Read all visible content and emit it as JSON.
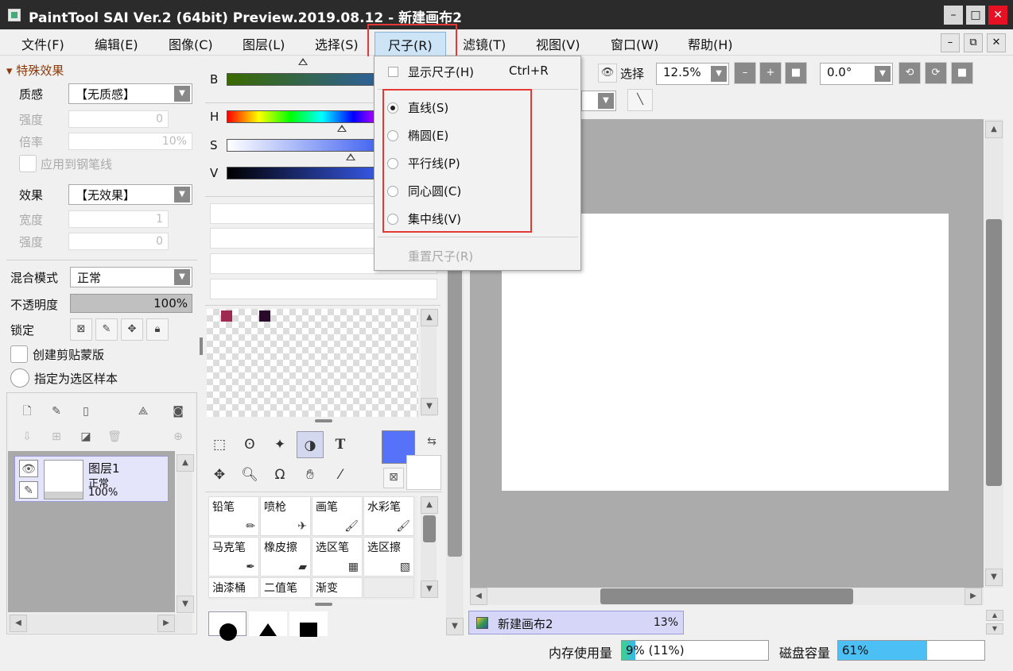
{
  "window": {
    "title": "PaintTool SAI Ver.2 (64bit) Preview.2019.08.12 - 新建画布2",
    "minimize": "–",
    "maximize": "□",
    "close": "✕"
  },
  "menubar": {
    "items": [
      "文件(F)",
      "编辑(E)",
      "图像(C)",
      "图层(L)",
      "选择(S)",
      "尺子(R)",
      "滤镜(T)",
      "视图(V)",
      "窗口(W)",
      "帮助(H)"
    ],
    "active_index": 5
  },
  "ruler_menu": {
    "show_ruler": "显示尺子(H)",
    "show_ruler_shortcut": "Ctrl+R",
    "modes": [
      "直线(S)",
      "椭圆(E)",
      "平行线(P)",
      "同心圆(C)",
      "集中线(V)"
    ],
    "selected_mode_index": 0,
    "reset": "重置尺子(R)"
  },
  "special_effects": {
    "header": "特殊效果",
    "texture_label": "质感",
    "texture_value": "【无质感】",
    "strength_label": "强度",
    "strength_value": "0",
    "scale_label": "倍率",
    "scale_value": "10%",
    "apply_to_pen": "应用到钢笔线",
    "effect_label": "效果",
    "effect_value": "【无效果】",
    "width_label": "宽度",
    "width_value": "1",
    "strength2_label": "强度",
    "strength2_value": "0"
  },
  "layer_props": {
    "blend_label": "混合模式",
    "blend_value": "正常",
    "opacity_label": "不透明度",
    "opacity_value": "100%",
    "opacity": 1.0,
    "lock_label": "锁定",
    "clip_mask": "创建剪贴蒙版",
    "selection_source": "指定为选区样本"
  },
  "layers": [
    {
      "name": "图层1",
      "mode": "正常",
      "opacity": "100%"
    }
  ],
  "color": {
    "b_label": "B",
    "h_label": "H",
    "s_label": "S",
    "v_label": "V",
    "main_color": "#5572f8",
    "swatches": [
      "#9e2a52",
      "#2a0a2a"
    ]
  },
  "brushes": [
    {
      "name": "铅笔",
      "icon": "pencil-icon"
    },
    {
      "name": "喷枪",
      "icon": "airbrush-icon"
    },
    {
      "name": "画笔",
      "icon": "brush-icon"
    },
    {
      "name": "水彩笔",
      "icon": "watercolor-icon"
    },
    {
      "name": "马克笔",
      "icon": "marker-icon"
    },
    {
      "name": "橡皮擦",
      "icon": "eraser-icon"
    },
    {
      "name": "选区笔",
      "icon": "select-pen-icon"
    },
    {
      "name": "选区擦",
      "icon": "select-eraser-icon"
    },
    {
      "name": "油漆桶",
      "icon": "bucket-icon"
    },
    {
      "name": "二值笔",
      "icon": "binary-pen-icon"
    },
    {
      "name": "渐变",
      "icon": "gradient-icon"
    }
  ],
  "view_toolbar": {
    "select_label": "选择",
    "zoom_value": "12.5%",
    "rotation_value": "0.0°"
  },
  "document_tab": {
    "name": "新建画布2",
    "zoom": "13%"
  },
  "status": {
    "memory_label": "内存使用量",
    "memory_value": "9% (11%)",
    "memory_fraction": 0.09,
    "disk_label": "磁盘容量",
    "disk_value": "61%",
    "disk_fraction": 0.61
  }
}
